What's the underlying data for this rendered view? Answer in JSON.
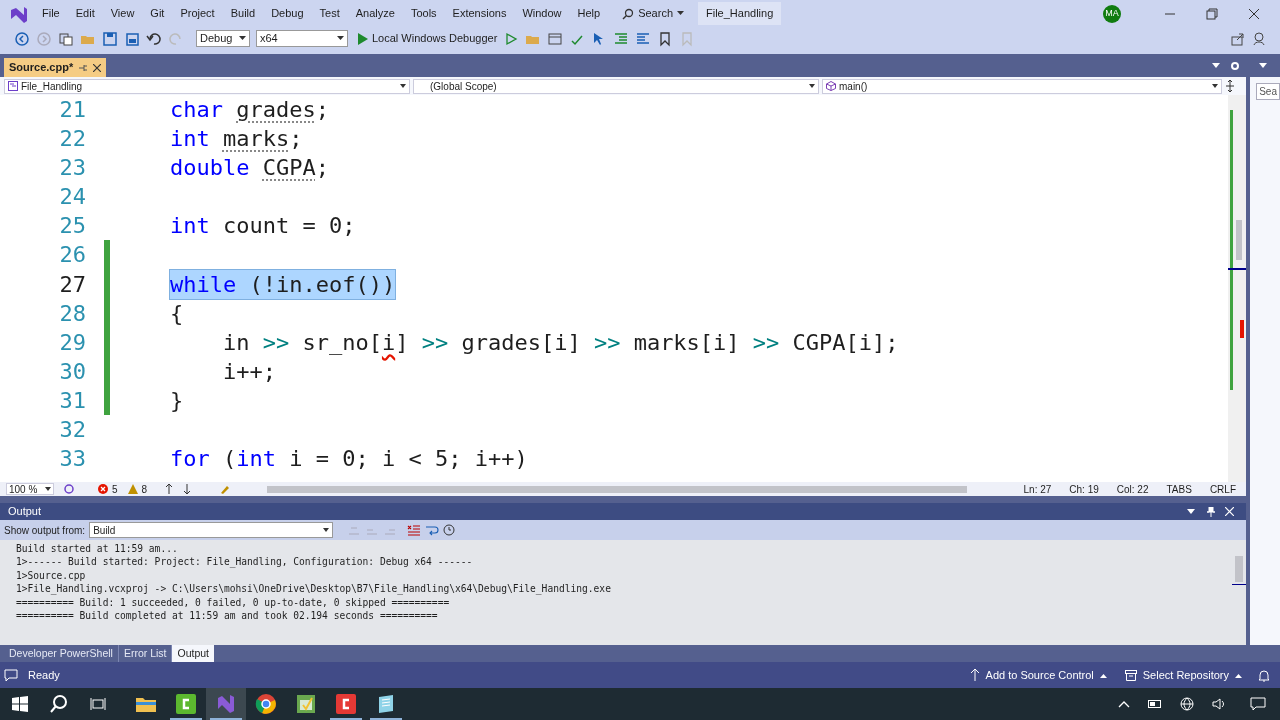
{
  "menu": [
    "File",
    "Edit",
    "View",
    "Git",
    "Project",
    "Build",
    "Debug",
    "Test",
    "Analyze",
    "Tools",
    "Extensions",
    "Window",
    "Help"
  ],
  "search": {
    "label": "Search"
  },
  "solution_title": "File_Handling",
  "account": {
    "initials": "MA",
    "color": "#107c10"
  },
  "toolbar": {
    "configuration": "Debug",
    "platform": "x64",
    "run_target": "Local Windows Debugger"
  },
  "document_tabs": [
    {
      "label": "Source.cpp*",
      "selected": true
    }
  ],
  "navigation": {
    "project": "File_Handling",
    "scope": "(Global Scope)",
    "member": "main()"
  },
  "side_panel": {
    "search_label": "Sea"
  },
  "code_lines": [
    {
      "number": "21",
      "changed": false,
      "highlighted": false,
      "tokens": [
        {
          "text": "char ",
          "kind": "keyword"
        },
        {
          "text": "grades",
          "kind": "hint"
        },
        {
          "text": ";",
          "kind": "plain"
        }
      ]
    },
    {
      "number": "22",
      "changed": false,
      "highlighted": false,
      "tokens": [
        {
          "text": "int ",
          "kind": "keyword"
        },
        {
          "text": "marks",
          "kind": "hint"
        },
        {
          "text": ";",
          "kind": "plain"
        }
      ]
    },
    {
      "number": "23",
      "changed": false,
      "highlighted": false,
      "tokens": [
        {
          "text": "double ",
          "kind": "keyword"
        },
        {
          "text": "CGPA",
          "kind": "hint"
        },
        {
          "text": ";",
          "kind": "plain"
        }
      ]
    },
    {
      "number": "24",
      "changed": false,
      "highlighted": false
    },
    {
      "number": "25",
      "changed": false,
      "highlighted": false,
      "tokens": [
        {
          "text": "int",
          "kind": "keyword"
        },
        {
          "text": " count = 0;",
          "kind": "plain"
        }
      ]
    },
    {
      "number": "26",
      "changed": true,
      "highlighted": false
    },
    {
      "number": "27",
      "changed": true,
      "highlighted": true,
      "tokens": [
        {
          "text": "while",
          "kind": "keyword"
        },
        {
          "text": " (!in.eof())",
          "kind": "plain"
        }
      ]
    },
    {
      "number": "28",
      "changed": true,
      "highlighted": false,
      "tokens": [
        {
          "text": "{",
          "kind": "plain"
        }
      ]
    },
    {
      "number": "29",
      "changed": true,
      "highlighted": false,
      "tokens": [
        {
          "text": "    in ",
          "kind": "plain"
        },
        {
          "text": ">>",
          "kind": "operator"
        },
        {
          "text": " sr_no[",
          "kind": "plain"
        },
        {
          "text": "i",
          "kind": "error"
        },
        {
          "text": "] ",
          "kind": "plain"
        },
        {
          "text": ">>",
          "kind": "operator"
        },
        {
          "text": " grades[i] ",
          "kind": "plain"
        },
        {
          "text": ">>",
          "kind": "operator"
        },
        {
          "text": " marks[i] ",
          "kind": "plain"
        },
        {
          "text": ">>",
          "kind": "operator"
        },
        {
          "text": " CGPA[i];",
          "kind": "plain"
        }
      ]
    },
    {
      "number": "30",
      "changed": true,
      "highlighted": false,
      "tokens": [
        {
          "text": "    i++;",
          "kind": "plain"
        }
      ]
    },
    {
      "number": "31",
      "changed": true,
      "highlighted": false,
      "tokens": [
        {
          "text": "}",
          "kind": "plain"
        }
      ]
    },
    {
      "number": "32",
      "changed": false,
      "highlighted": false
    },
    {
      "number": "33",
      "changed": false,
      "highlighted": false,
      "tokens": [
        {
          "text": "for",
          "kind": "keyword"
        },
        {
          "text": " (",
          "kind": "plain"
        },
        {
          "text": "int",
          "kind": "keyword"
        },
        {
          "text": " i = 0; i < 5; i++)",
          "kind": "plain"
        }
      ]
    }
  ],
  "editor_status": {
    "zoom": "100 %",
    "errors": "5",
    "warnings": "8",
    "line": "Ln: 27",
    "char": "Ch: 19",
    "column": "Col: 22",
    "indent_mode": "TABS",
    "line_endings": "CRLF"
  },
  "output": {
    "title": "Output",
    "source_label": "Show output from:",
    "source": "Build",
    "lines": [
      "Build started at 11:59 am...",
      "1>------ Build started: Project: File_Handling, Configuration: Debug x64 ------",
      "1>Source.cpp",
      "1>File_Handling.vcxproj -> C:\\Users\\mohsi\\OneDrive\\Desktop\\B7\\File_Handling\\x64\\Debug\\File_Handling.exe",
      "========== Build: 1 succeeded, 0 failed, 0 up-to-date, 0 skipped ==========",
      "========== Build completed at 11:59 am and took 02.194 seconds =========="
    ]
  },
  "tool_tabs": [
    {
      "label": "Developer PowerShell",
      "selected": false
    },
    {
      "label": "Error List",
      "selected": false
    },
    {
      "label": "Output",
      "selected": true
    }
  ],
  "status_bar": {
    "state": "Ready",
    "source_control": "Add to Source Control",
    "repository": "Select Repository"
  },
  "taskbar_apps": [
    {
      "kind": "folder",
      "running": false,
      "selected": false
    },
    {
      "kind": "green",
      "running": true,
      "selected": false
    },
    {
      "kind": "purple",
      "running": true,
      "selected": true
    },
    {
      "kind": "browser",
      "running": false,
      "selected": false
    },
    {
      "kind": "sheet",
      "running": false,
      "selected": false
    },
    {
      "kind": "red",
      "running": true,
      "selected": false
    },
    {
      "kind": "notes",
      "running": true,
      "selected": false
    }
  ]
}
